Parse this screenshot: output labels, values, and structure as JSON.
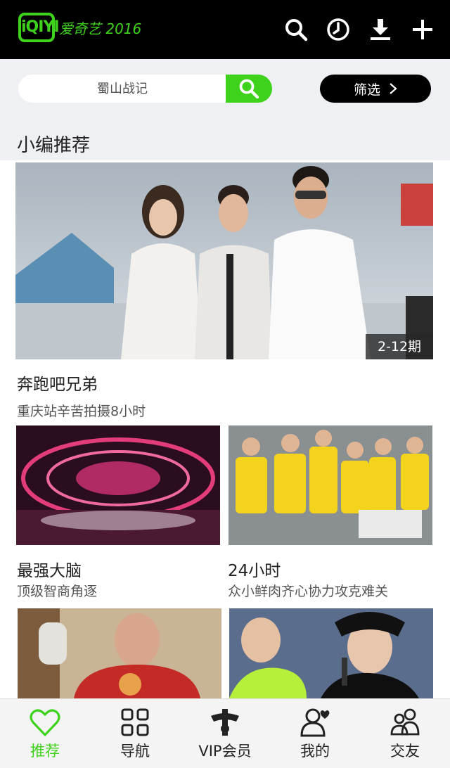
{
  "header": {
    "logo_mark": "iQIYI",
    "logo_text": "爱奇艺 2016",
    "icons": [
      "search-icon",
      "history-icon",
      "download-icon",
      "add-icon"
    ]
  },
  "search": {
    "placeholder": "蜀山战记",
    "filter_label": "筛选"
  },
  "section": {
    "title": "小编推荐"
  },
  "hero": {
    "badge": "2-12期",
    "title": "奔跑吧兄弟",
    "subtitle": "重庆站辛苦拍摄8小时"
  },
  "cards": [
    {
      "title": "最强大脑",
      "subtitle": "顶级智商角逐"
    },
    {
      "title": "24小时",
      "subtitle": "众小鲜肉齐心协力攻克难关"
    },
    {
      "title": "",
      "subtitle": ""
    },
    {
      "title": "",
      "subtitle": ""
    }
  ],
  "bottom_nav": [
    {
      "label": "推荐",
      "icon": "heart-icon",
      "active": true
    },
    {
      "label": "导航",
      "icon": "grid-icon",
      "active": false
    },
    {
      "label": "VIP会员",
      "icon": "vip-crown-icon",
      "active": false
    },
    {
      "label": "我的",
      "icon": "user-icon",
      "active": false
    },
    {
      "label": "交友",
      "icon": "friends-icon",
      "active": false
    }
  ],
  "colors": {
    "brand": "#3fd21c",
    "topbar": "#000000",
    "background": "#eff0f4"
  }
}
